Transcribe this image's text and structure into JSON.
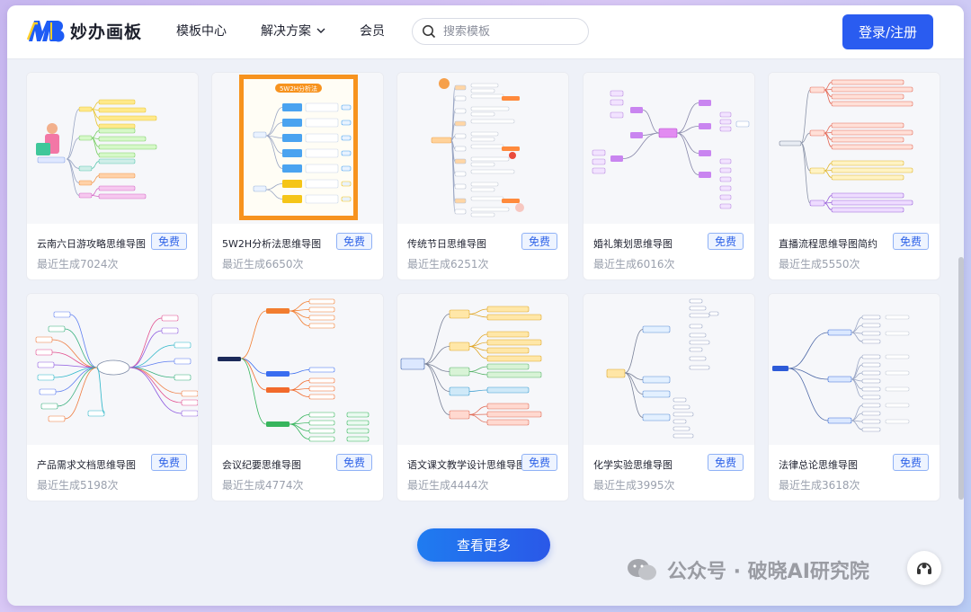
{
  "header": {
    "logo_mark": "MB",
    "logo_text": "妙办画板",
    "nav": [
      "模板中心",
      "解决方案",
      "会员"
    ],
    "search_placeholder": "搜索模板",
    "login_label": "登录/注册"
  },
  "cards": [
    {
      "title": "云南六日游攻略思维导图",
      "badge": "免费",
      "meta": "最近生成7024次",
      "thumb": "mindmap-left"
    },
    {
      "title": "5W2H分析法思维导图",
      "badge": "免费",
      "meta": "最近生成6650次",
      "thumb": "5w2h",
      "thumb_title": "5W2H分析法"
    },
    {
      "title": "传统节日思维导图",
      "badge": "免费",
      "meta": "最近生成6251次",
      "thumb": "festival"
    },
    {
      "title": "婚礼策划思维导图",
      "badge": "免费",
      "meta": "最近生成6016次",
      "thumb": "wedding"
    },
    {
      "title": "直播流程思维导图简约",
      "badge": "免费",
      "meta": "最近生成5550次",
      "thumb": "live"
    },
    {
      "title": "产品需求文档思维导图",
      "badge": "免费",
      "meta": "最近生成5198次",
      "thumb": "radial"
    },
    {
      "title": "会议纪要思维导图",
      "badge": "免费",
      "meta": "最近生成4774次",
      "thumb": "meeting"
    },
    {
      "title": "语文课文教学设计思维导图",
      "badge": "免费",
      "meta": "最近生成4444次",
      "thumb": "chinese"
    },
    {
      "title": "化学实验思维导图",
      "badge": "免费",
      "meta": "最近生成3995次",
      "thumb": "chemistry"
    },
    {
      "title": "法律总论思维导图",
      "badge": "免费",
      "meta": "最近生成3618次",
      "thumb": "law"
    }
  ],
  "more_label": "查看更多",
  "watermark": "公众号 · 破晓AI研究院",
  "colors": {
    "primary": "#2a5cf0",
    "badge_text": "#2f63e8",
    "badge_bg": "#eef4ff",
    "meta": "#9aa0ad"
  }
}
